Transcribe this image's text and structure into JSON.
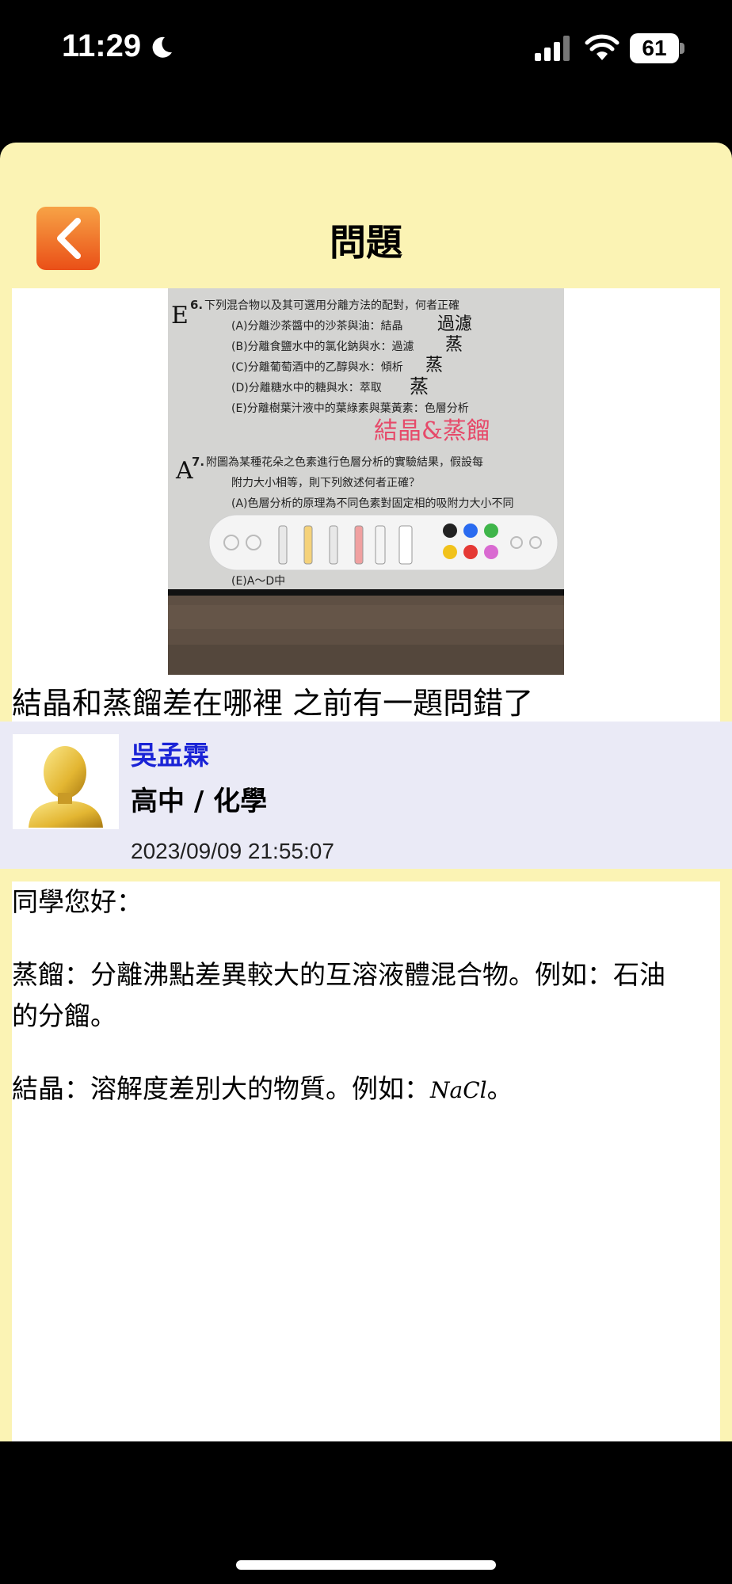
{
  "status_bar": {
    "time": "11:29",
    "battery": "61"
  },
  "header": {
    "title": "問題"
  },
  "question": {
    "text": "結晶和蒸餾差在哪裡 之前有一題問錯了"
  },
  "photo": {
    "q6_num": "6.",
    "q6_stem": "下列混合物以及其可選用分離方法的配對，何者正確",
    "q6_a": "(A)分離沙茶醬中的沙茶與油：結晶",
    "q6_b": "(B)分離食鹽水中的氯化鈉與水：過濾",
    "q6_c": "(C)分離葡萄酒中的乙醇與水：傾析",
    "q6_d": "(D)分離糖水中的糖與水：萃取",
    "q6_e": "(E)分離樹葉汁液中的葉綠素與葉黃素：色層分析",
    "q6_mark": "E",
    "hw_a": "過濾",
    "hw_b": "蒸",
    "hw_c": "蒸",
    "hw_d": "蒸",
    "hw_red": "結晶&蒸餾",
    "q7_mark": "A",
    "q7_num": "7.",
    "q7_stem": "附圖為某種花朵之色素進行色層分析的實驗結果，假設每",
    "q7_stem2": "附力大小相等，則下列敘述何者正確？",
    "q7_a": "(A)色層分析的原理為不同色素對固定相的吸附力大小不同",
    "q7_e": "(E)A～D中"
  },
  "author": {
    "name": "吳孟霖",
    "subject": "高中 / 化學",
    "datetime": "2023/09/09 21:55:07"
  },
  "answer": {
    "greeting": "同學您好：",
    "distill_line1": "蒸餾：分離沸點差異較大的互溶液體混合物。例如：石油",
    "distill_line2": "的分餾。",
    "crystal_prefix": "結晶：溶解度差別大的物質。例如：",
    "crystal_formula": "NaCl",
    "crystal_suffix": "。"
  }
}
